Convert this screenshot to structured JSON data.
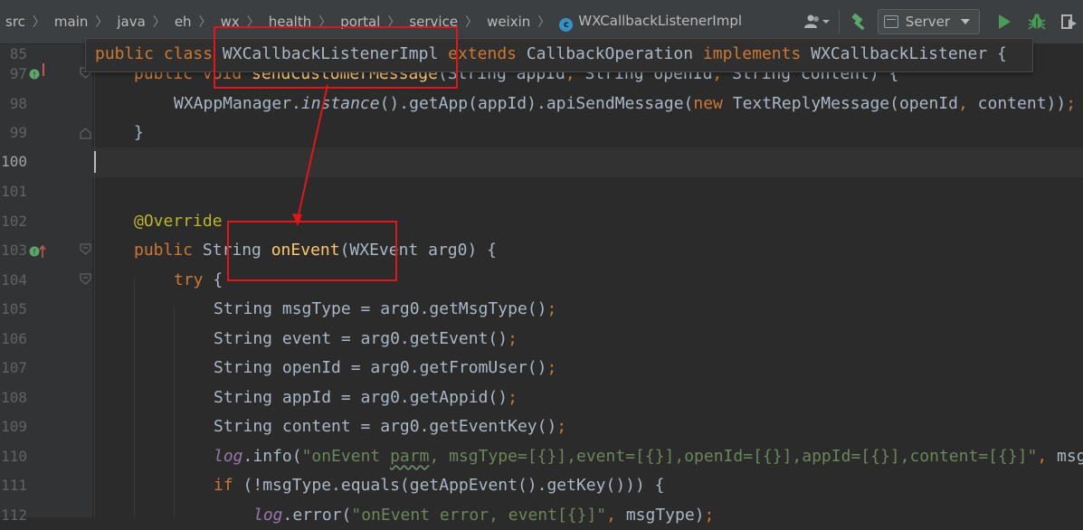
{
  "breadcrumb": {
    "items": [
      "src",
      "main",
      "java",
      "eh",
      "wx",
      "health",
      "portal",
      "service",
      "weixin"
    ],
    "current": "WXCallbackListenerImpl",
    "current_icon": "class-icon",
    "current_icon_letter": "c"
  },
  "toolbar": {
    "user_icon": "user-dropdown-icon",
    "build_icon": "hammer-icon",
    "run_config": "Server",
    "run_icon": "run-icon",
    "debug_icon": "debug-icon",
    "coverage_icon": "coverage-icon"
  },
  "sticky_header": {
    "line_number": "85",
    "code": "public class WXCallbackListenerImpl extends CallbackOperation implements WXCallbackListener {"
  },
  "lines": [
    {
      "number": "97",
      "code": "public void sendCustomerMessage(String appId, String openId, String content) {"
    },
    {
      "number": "98",
      "code": "WXAppManager.instance().getApp(appId).apiSendMessage(new TextReplyMessage(openId, content));"
    },
    {
      "number": "99",
      "code": "}"
    },
    {
      "number": "100",
      "code": ""
    },
    {
      "number": "101",
      "code": ""
    },
    {
      "number": "102",
      "code": "@Override"
    },
    {
      "number": "103",
      "code": "public String onEvent(WXEvent arg0) {"
    },
    {
      "number": "104",
      "code": "try {"
    },
    {
      "number": "105",
      "code": "String msgType = arg0.getMsgType();"
    },
    {
      "number": "106",
      "code": "String event = arg0.getEvent();"
    },
    {
      "number": "107",
      "code": "String openId = arg0.getFromUser();"
    },
    {
      "number": "108",
      "code": "String appId = arg0.getAppid();"
    },
    {
      "number": "109",
      "code": "String content = arg0.getEventKey();"
    },
    {
      "number": "110",
      "code": "log.info(\"onEvent parm, msgType=[{}],event=[{}],openId=[{}],appId=[{}],content=[{}]\", msgType"
    },
    {
      "number": "111",
      "code": "if (!msgType.equals(getAppEvent().getKey())) {"
    },
    {
      "number": "112",
      "code": "log.error(\"onEvent error, event[{}]\", msgType);"
    }
  ],
  "colors": {
    "editor_bg": "#2b2b2b",
    "gutter_bg": "#313335",
    "keyword": "#cc7832",
    "annotation": "#bbb529",
    "string": "#6a8759",
    "field": "#9876aa",
    "method": "#ffc66d",
    "highlight_box": "#e0161b"
  },
  "annotations": {
    "boxes": [
      "class-name-highlight",
      "method-name-highlight"
    ],
    "arrow": "class-to-method-arrow"
  }
}
